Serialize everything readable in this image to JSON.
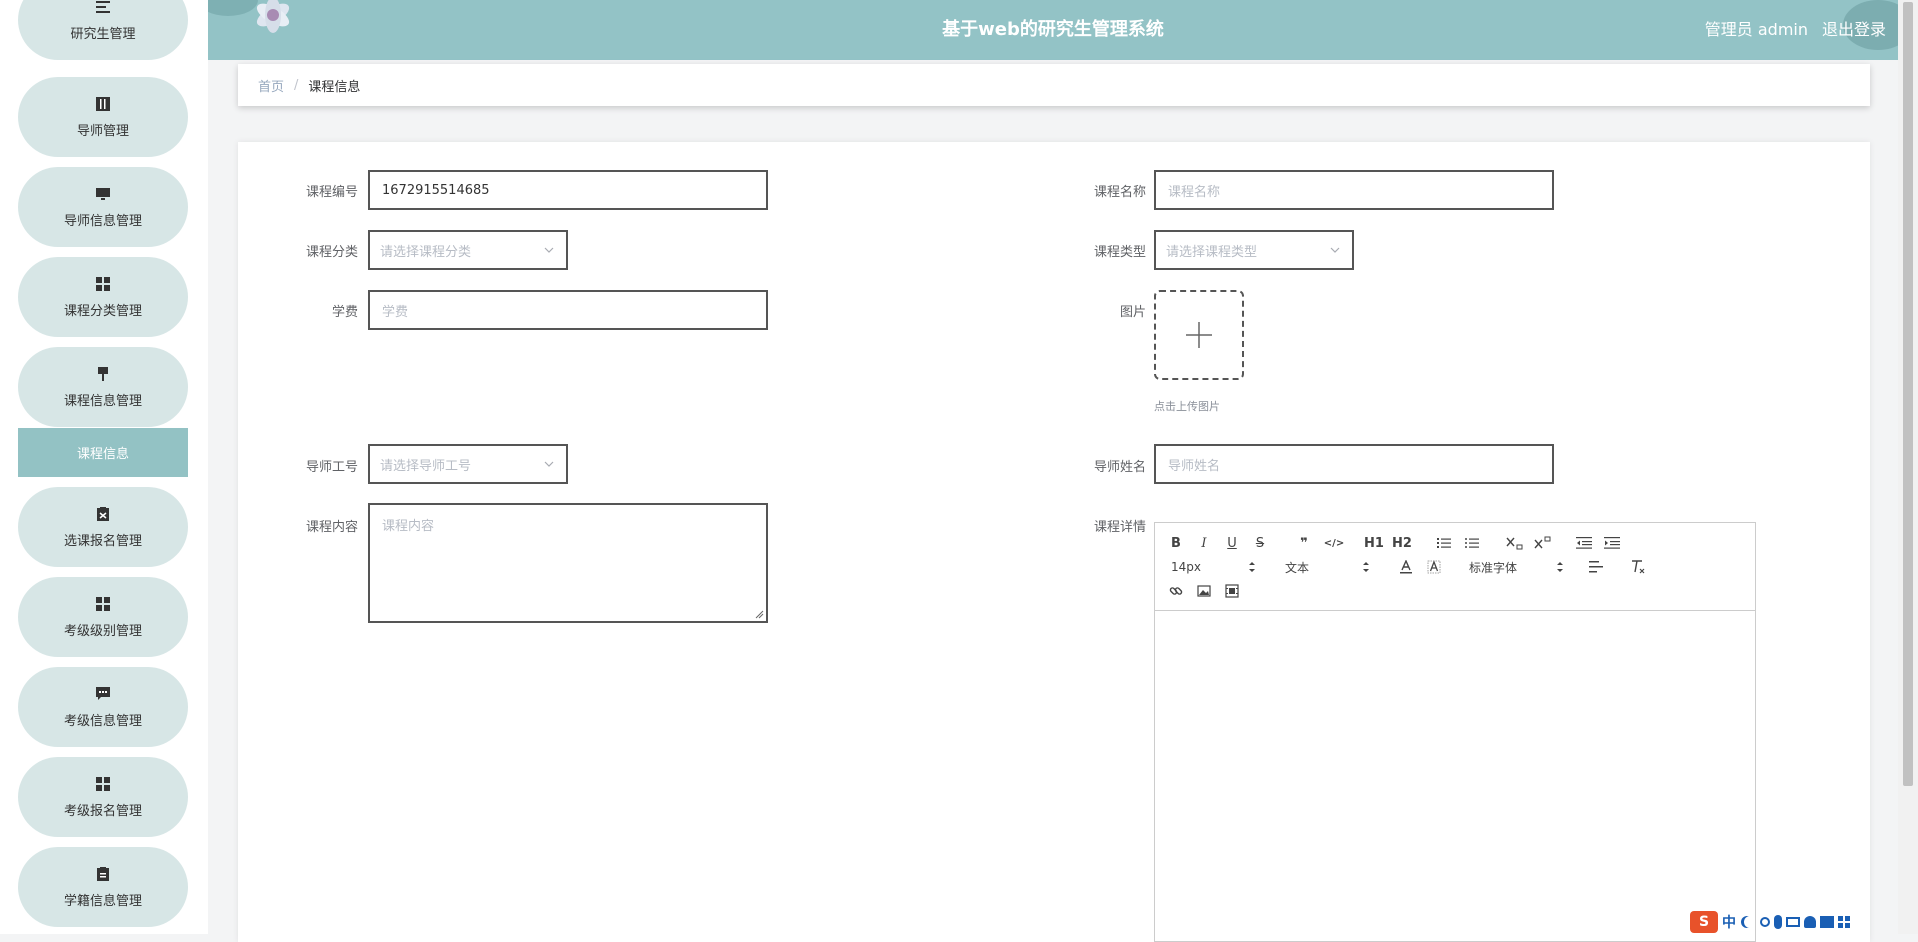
{
  "header": {
    "title": "基于web的研究生管理系统",
    "user": "管理员 admin",
    "logout": "退出登录"
  },
  "sidebar": {
    "items": [
      {
        "label": "研究生管理",
        "icon": "list-icon"
      },
      {
        "label": "导师管理",
        "icon": "book-icon"
      },
      {
        "label": "导师信息管理",
        "icon": "monitor-icon"
      },
      {
        "label": "课程分类管理",
        "icon": "grid-icon"
      },
      {
        "label": "课程信息管理",
        "icon": "brush-icon"
      },
      {
        "label": "选课报名管理",
        "icon": "clipboard-x-icon"
      },
      {
        "label": "考级级别管理",
        "icon": "grid-icon"
      },
      {
        "label": "考级信息管理",
        "icon": "chat-icon"
      },
      {
        "label": "考级报名管理",
        "icon": "grid-icon"
      },
      {
        "label": "学籍信息管理",
        "icon": "clipboard-icon"
      }
    ],
    "active_sub": "课程信息"
  },
  "breadcrumb": {
    "home": "首页",
    "separator": "/",
    "current": "课程信息"
  },
  "form": {
    "course_no_label": "课程编号",
    "course_no_value": "1672915514685",
    "course_name_label": "课程名称",
    "course_name_placeholder": "课程名称",
    "category_label": "课程分类",
    "category_placeholder": "请选择课程分类",
    "type_label": "课程类型",
    "type_placeholder": "请选择课程类型",
    "fee_label": "学费",
    "fee_placeholder": "学费",
    "image_label": "图片",
    "upload_tip": "点击上传图片",
    "tutor_no_label": "导师工号",
    "tutor_no_placeholder": "请选择导师工号",
    "tutor_name_label": "导师姓名",
    "tutor_name_placeholder": "导师姓名",
    "content_label": "课程内容",
    "content_placeholder": "课程内容",
    "detail_label": "课程详情"
  },
  "editor": {
    "font_size": "14px",
    "header_select": "文本",
    "font_family": "标准字体",
    "buttons": {
      "bold": "B",
      "italic": "I",
      "underline": "U",
      "strike": "S",
      "quote": "❞",
      "code": "</>",
      "h1": "H1",
      "h2": "H2"
    }
  },
  "ime": {
    "lang": "中"
  },
  "colors": {
    "header_bg": "#93c3c6",
    "pill_bg": "#d7e6e6",
    "active_sub_bg": "#93c2c4"
  }
}
